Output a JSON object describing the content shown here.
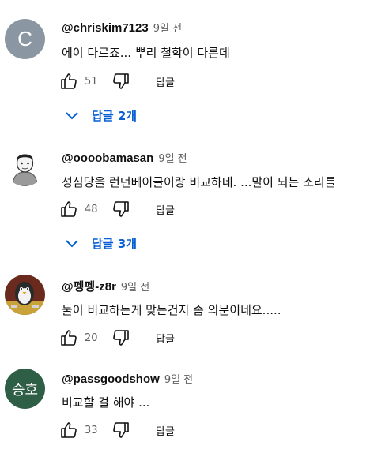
{
  "comments": [
    {
      "avatar_letter": "C",
      "avatar_color": "#8a97a3",
      "author": "@chriskim7123",
      "time": "9일 전",
      "text": "에이 다르죠... 뿌리 철학이 다른데",
      "likes": "51",
      "reply_label": "답글",
      "replies_label": "답글 2개"
    },
    {
      "avatar_icon": "cartoon-person-avatar",
      "author": "@oooobamasan",
      "time": "9일 전",
      "text": "성심당을 런던베이글이랑 비교하네. ...말이 되는 소리를",
      "likes": "48",
      "reply_label": "답글",
      "replies_label": "답글 3개"
    },
    {
      "avatar_icon": "penguin-avatar",
      "author": "@펭펭-z8r",
      "time": "9일 전",
      "text": "둘이 비교하는게 맞는건지 좀 의문이네요.....",
      "likes": "20",
      "reply_label": "답글"
    },
    {
      "avatar_text": "승호",
      "avatar_color": "#2e5e45",
      "author": "@passgoodshow",
      "time": "9일 전",
      "text": "비교할 걸 해야 ...",
      "likes": "33",
      "reply_label": "답글"
    }
  ],
  "colors": {
    "link_blue": "#065fd4",
    "meta_gray": "#606060"
  }
}
